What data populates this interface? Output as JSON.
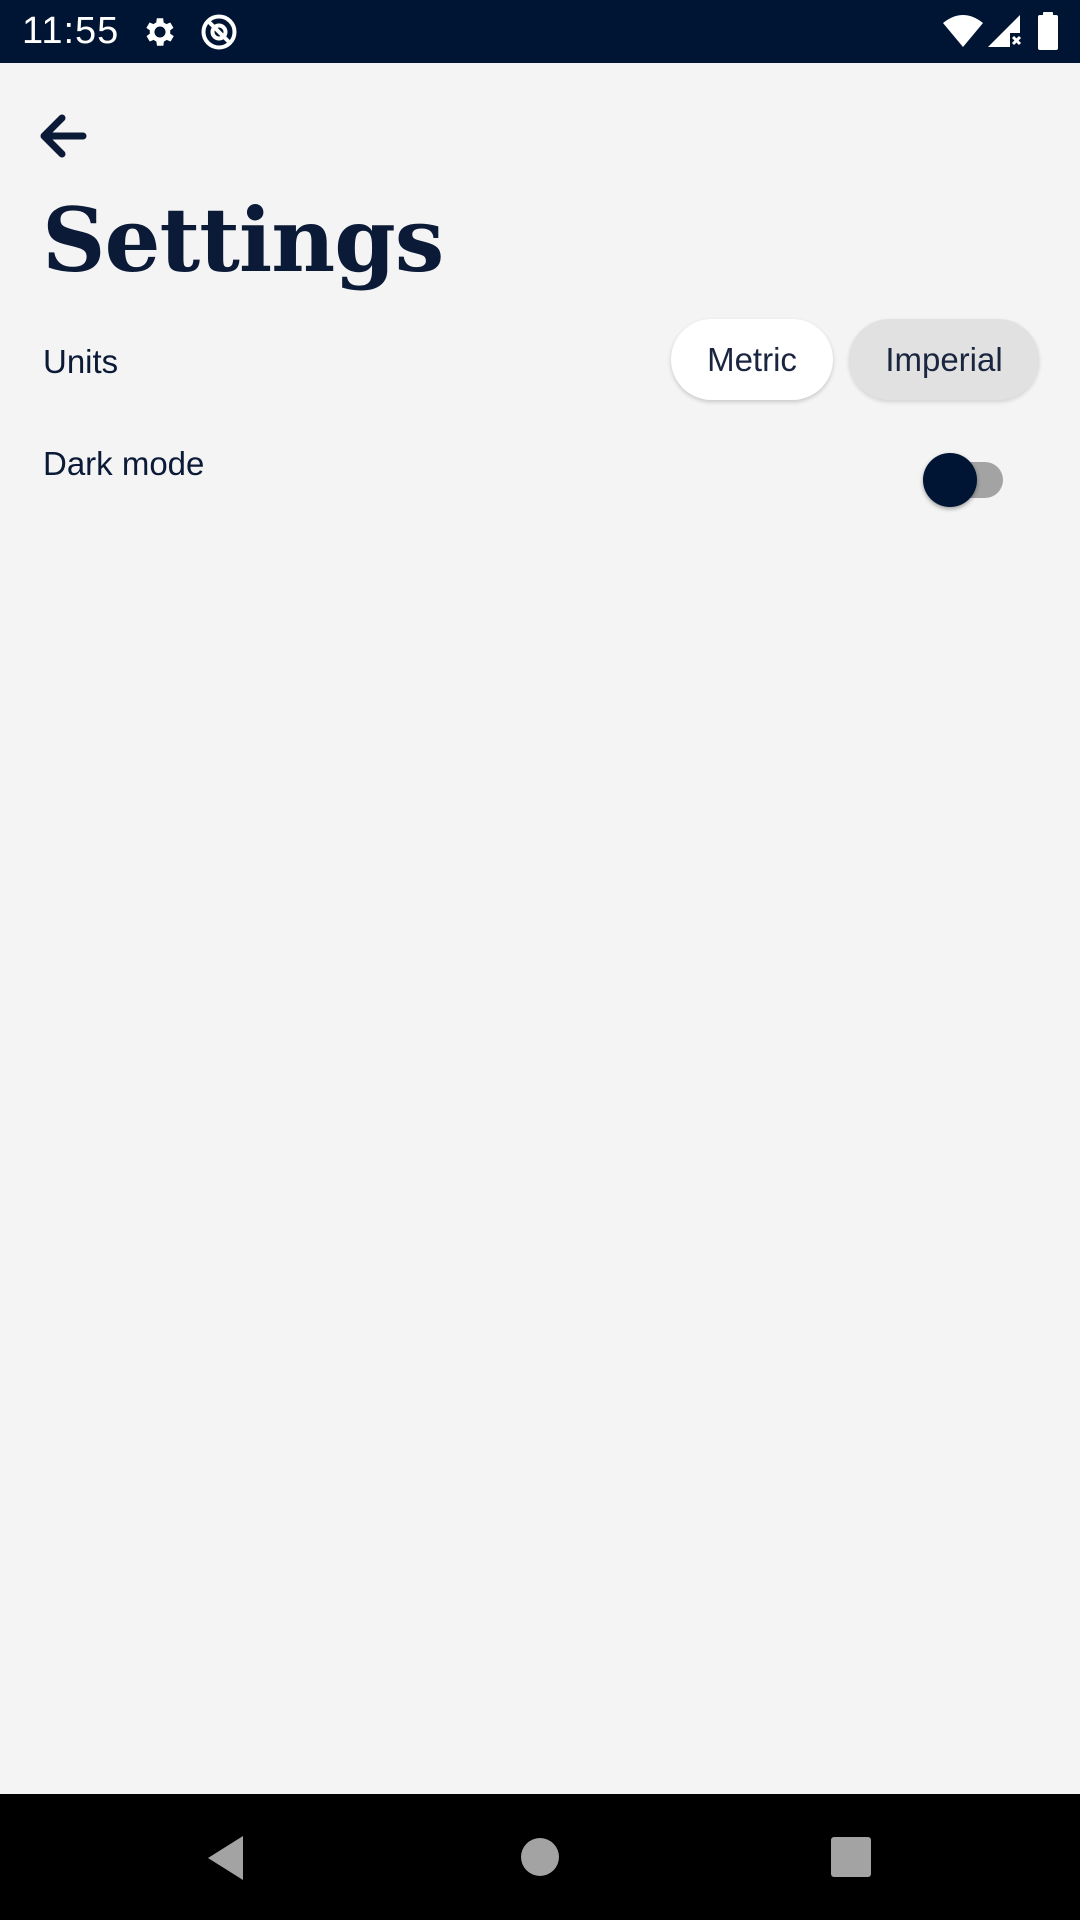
{
  "status_bar": {
    "time": "11:55",
    "icons": [
      "gear-icon",
      "at-sign-icon",
      "wifi-icon",
      "signal-icon",
      "battery-icon"
    ]
  },
  "header": {
    "back_icon": "arrow-left-icon",
    "title": "Settings"
  },
  "settings": {
    "units": {
      "label": "Units",
      "options": [
        "Metric",
        "Imperial"
      ],
      "selected": "Imperial"
    },
    "dark_mode": {
      "label": "Dark mode",
      "enabled": false
    }
  },
  "nav_bar": {
    "buttons": [
      "back-triangle-icon",
      "home-circle-icon",
      "recents-square-icon"
    ]
  },
  "colors": {
    "status_bar_bg": "#001533",
    "page_bg": "#f4f4f4",
    "text": "#0b1a36",
    "toggle_thumb": "#001533",
    "toggle_track": "#a3a3a3"
  }
}
